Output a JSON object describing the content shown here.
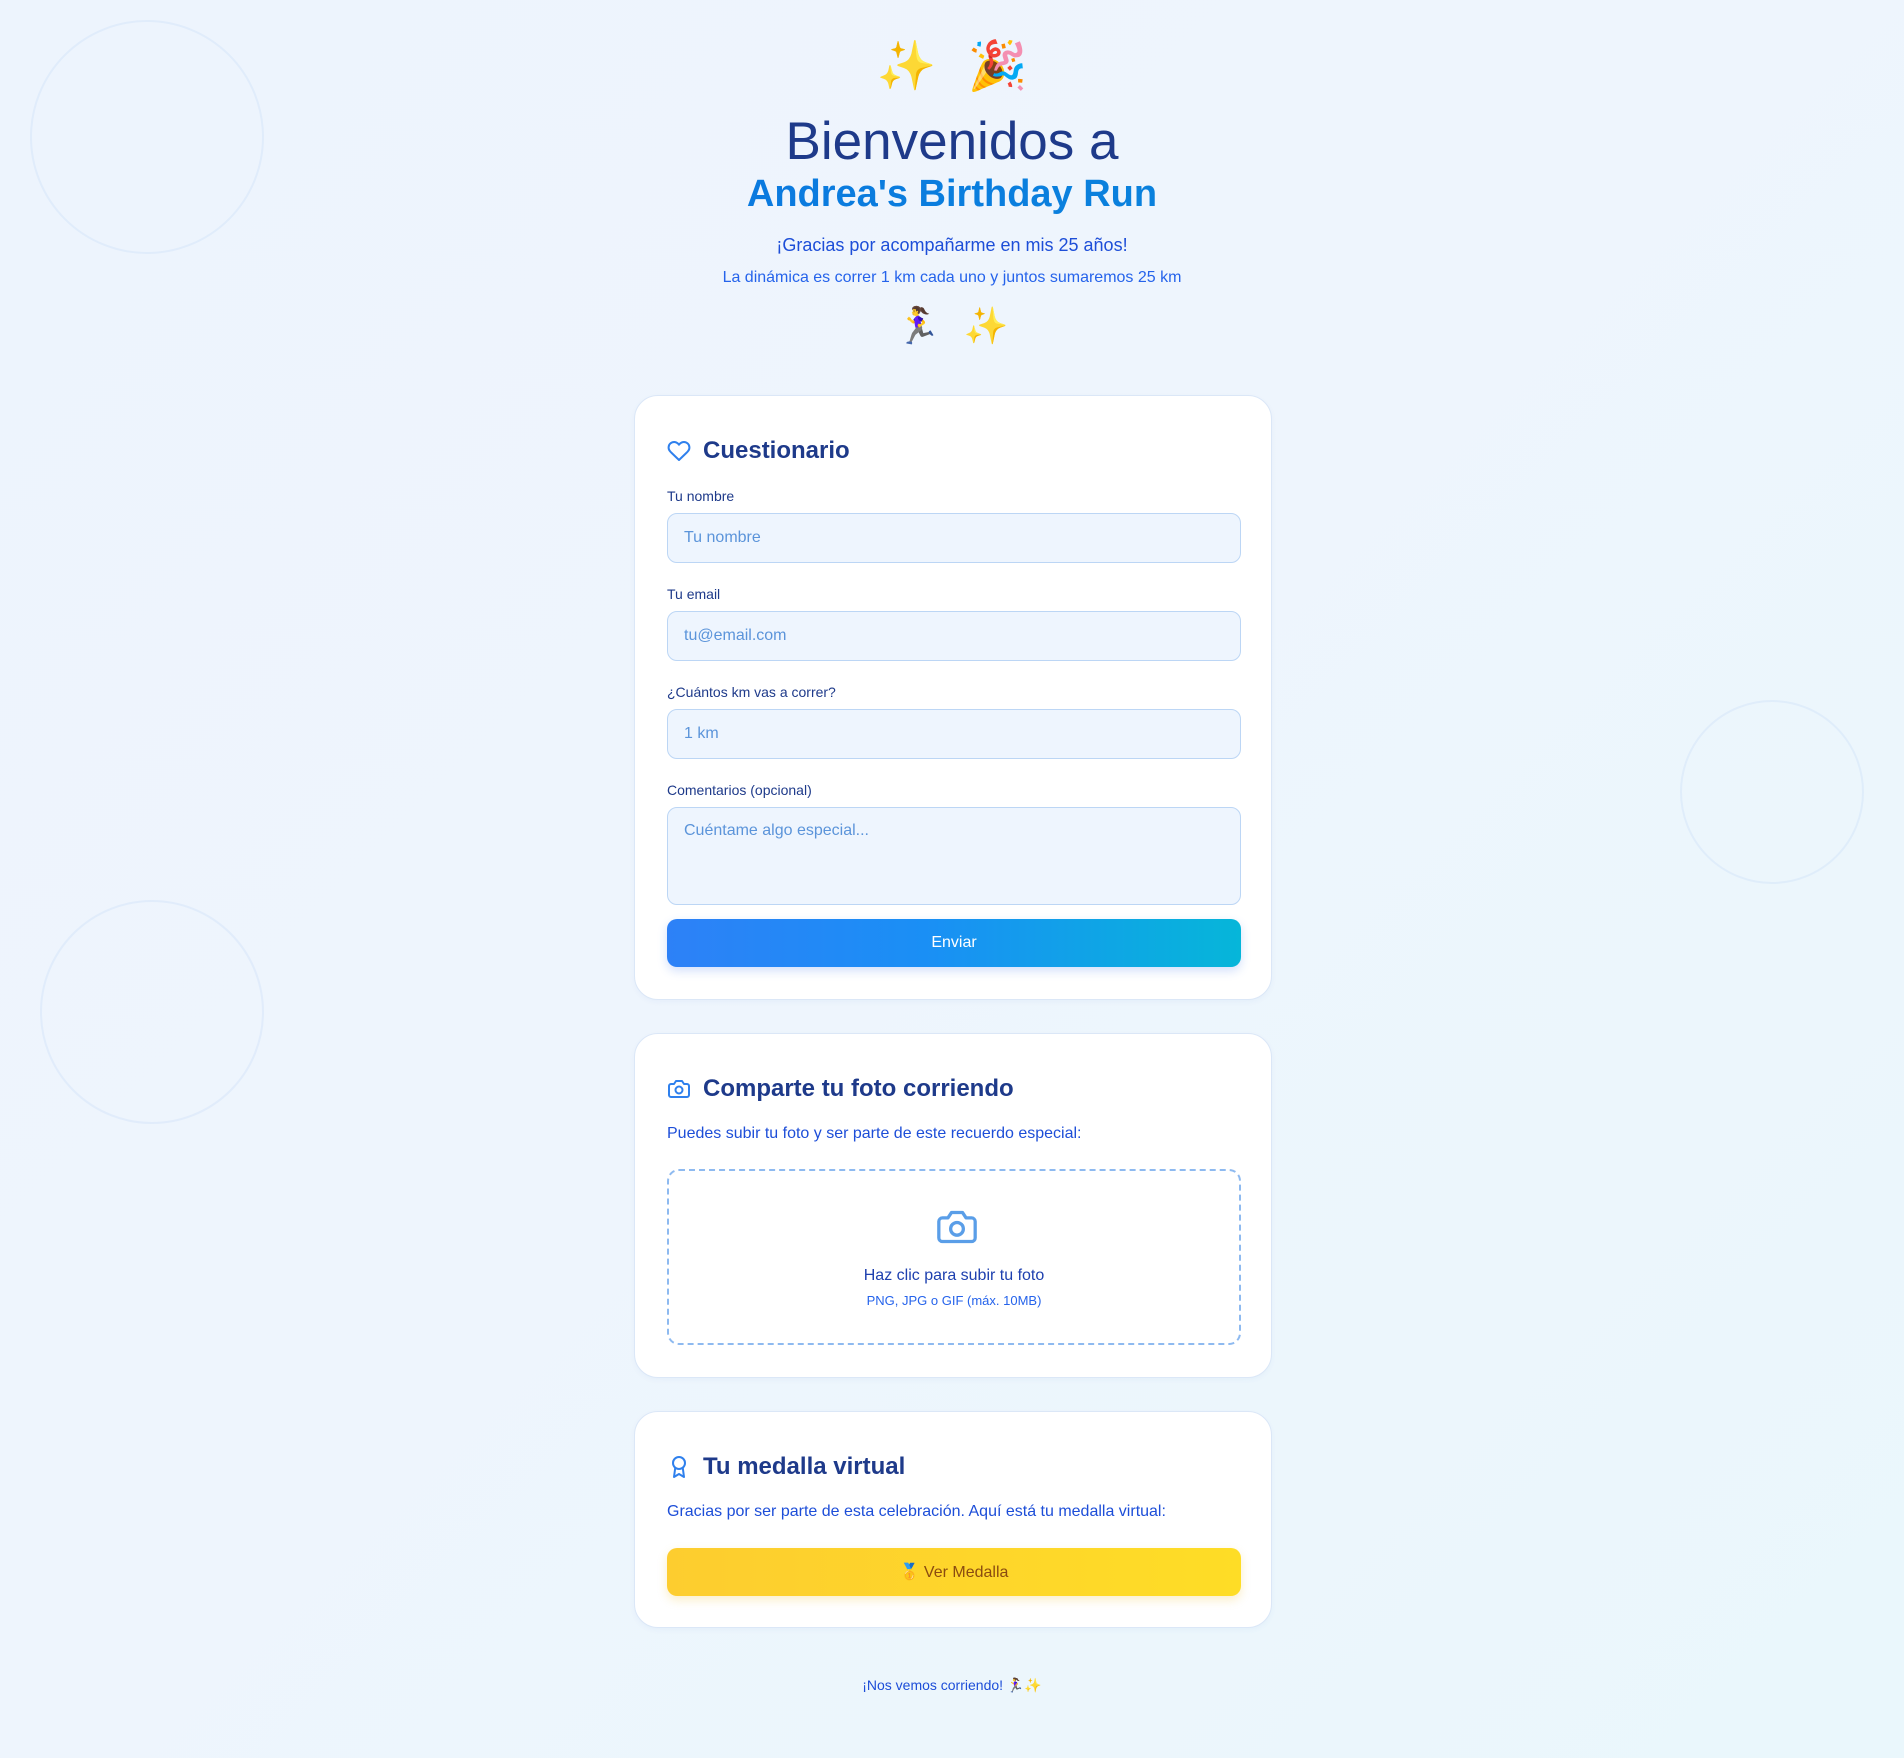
{
  "hero": {
    "top_emojis": [
      "✨",
      "🎉"
    ],
    "title": "Bienvenidos a",
    "subtitle": "Andrea's Birthday Run",
    "thanks": "¡Gracias por acompañarme en mis 25 años!",
    "dynamics": "La dinámica es correr 1 km cada uno y juntos sumaremos 25 km",
    "mid_emojis": [
      "🏃‍♀️",
      "✨"
    ]
  },
  "questionnaire": {
    "icon": "heart-icon",
    "title": "Cuestionario",
    "name_label": "Tu nombre",
    "name_placeholder": "Tu nombre",
    "email_label": "Tu email",
    "email_placeholder": "tu@email.com",
    "km_label": "¿Cuántos km vas a correr?",
    "km_placeholder": "1 km",
    "comments_label": "Comentarios (opcional)",
    "comments_placeholder": "Cuéntame algo especial...",
    "submit_label": "Enviar"
  },
  "photo": {
    "icon": "camera-icon",
    "title": "Comparte tu foto corriendo",
    "description": "Puedes subir tu foto y ser parte de este recuerdo especial:",
    "upload_label": "Haz clic para subir tu foto",
    "upload_hint": "PNG, JPG o GIF (máx. 10MB)"
  },
  "medal": {
    "icon": "award-icon",
    "title": "Tu medalla virtual",
    "description": "Gracias por ser parte de esta celebración. Aquí está tu medalla virtual:",
    "button_label": "🥇 Ver Medalla"
  },
  "footer": {
    "text": "¡Nos vemos corriendo! 🏃‍♀️✨"
  },
  "colors": {
    "primary_text": "#1e3a8a",
    "accent_blue": "#2563eb",
    "button_gradient_start": "#2d81f7",
    "button_gradient_end": "#06b6d9",
    "medal_button": "#fdd52a"
  }
}
